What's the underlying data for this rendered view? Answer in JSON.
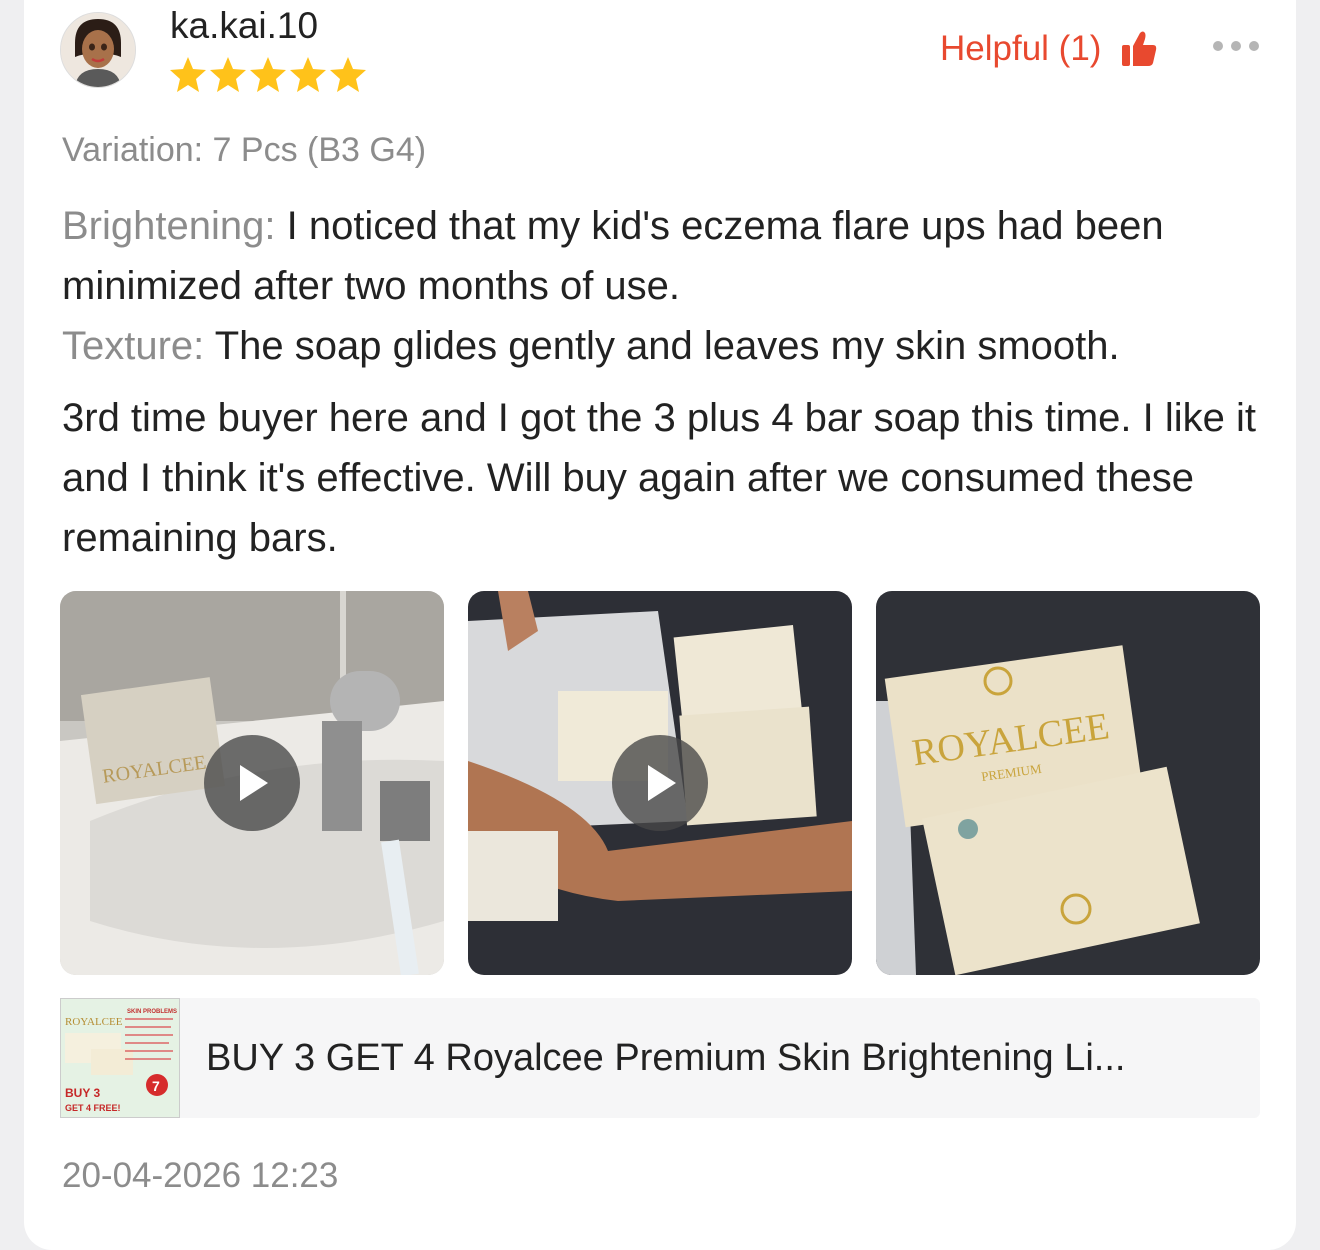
{
  "review": {
    "username": "ka.kai.10",
    "rating": 5,
    "rating_max": 5,
    "helpful_label": "Helpful (1)",
    "variation": "Variation: 7 Pcs (B3 G4)",
    "attributes": [
      {
        "label": "Brightening:",
        "value": " I noticed that my kid's eczema flare ups had been minimized after two months of use."
      },
      {
        "label": "Texture:",
        "value": " The soap glides gently and leaves my skin smooth."
      }
    ],
    "body": "3rd time buyer here and I got the 3 plus 4 bar soap this time. I like it and I think it's effective. Will buy again after we consumed these remaining bars.",
    "media": [
      {
        "type": "video",
        "brand_text": "ROYALCEE"
      },
      {
        "type": "video",
        "brand_text": ""
      },
      {
        "type": "video",
        "brand_text": "ROYALCEE",
        "sub_text": "PREMIUM"
      }
    ],
    "product": {
      "title": "BUY 3 GET 4 Royalcee Premium Skin Brightening Li...",
      "thumb_text_top": "ROYALCEE",
      "thumb_text_skin": "SKIN PROBLEMS",
      "thumb_text_buy": "BUY 3",
      "thumb_text_get": "GET 4 FREE!",
      "thumb_badge": "7"
    },
    "timestamp": "20-04-2026 12:23"
  },
  "colors": {
    "accent": "#e8492f",
    "star": "#ffc21a",
    "muted_text": "#8c8c8c",
    "body_text": "#222222"
  },
  "icons": {
    "more": "more-dots-icon",
    "helpful": "thumbs-up-icon",
    "play": "play-icon",
    "star": "star-icon"
  }
}
